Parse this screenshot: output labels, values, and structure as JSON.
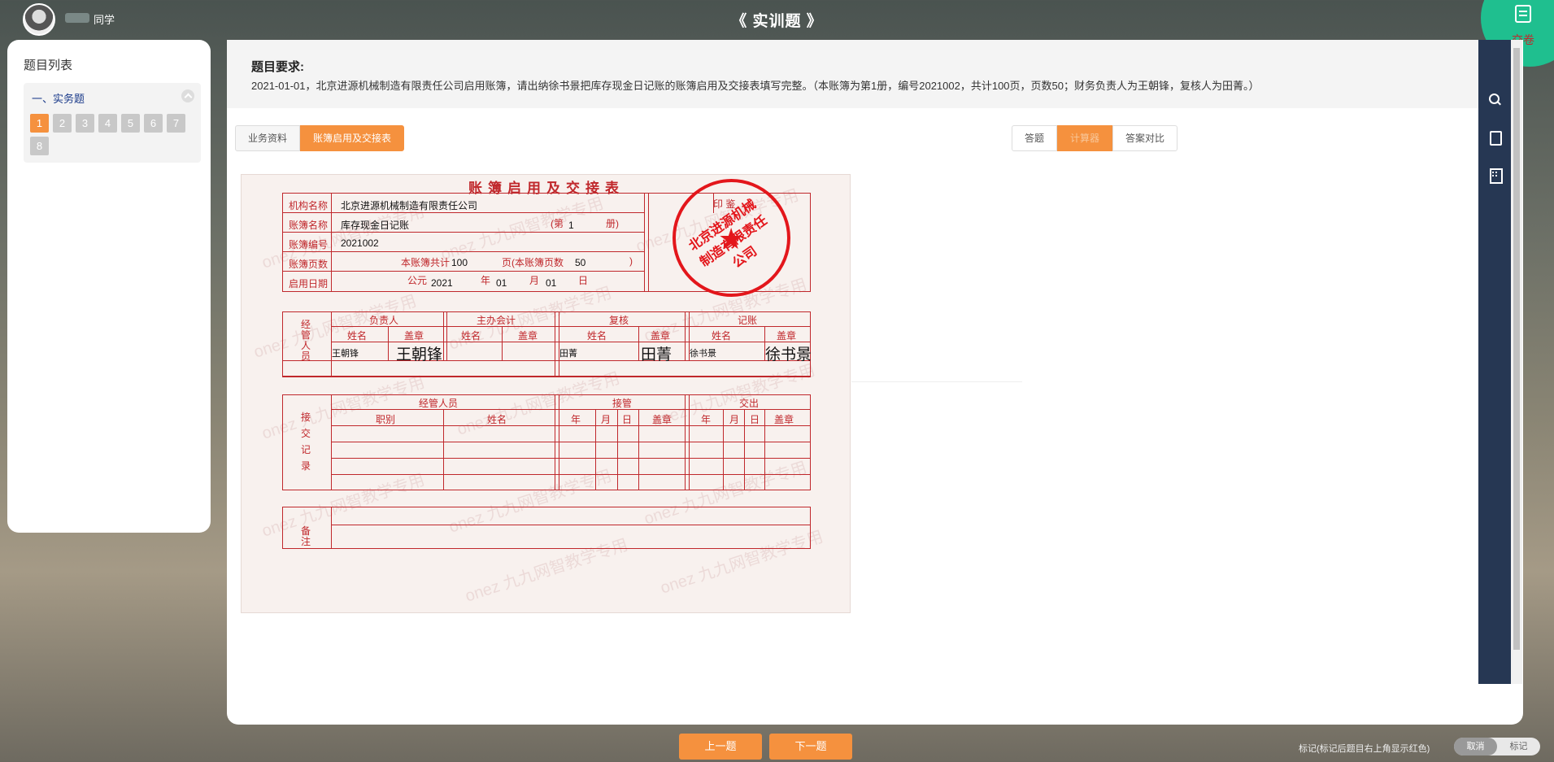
{
  "user": {
    "suffix": "同学"
  },
  "page_title": "《 实训题 》",
  "submit_label": "交卷",
  "left_panel": {
    "title": "题目列表",
    "section_title": "一、实务题",
    "questions": [
      "1",
      "2",
      "3",
      "4",
      "5",
      "6",
      "7",
      "8"
    ],
    "active_question": "1"
  },
  "requirement": {
    "title": "题目要求:",
    "text": "2021-01-01，北京进源机械制造有限责任公司启用账簿，请出纳徐书景把库存现金日记账的账簿启用及交接表填写完整。（本账簿为第1册，编号2021002，共计100页，页数50；财务负责人为王朝锋，复核人为田菁。）"
  },
  "tabs_left": [
    "业务资料",
    "账簿启用及交接表"
  ],
  "tabs_right": [
    "答题",
    "计算器",
    "答案对比"
  ],
  "form": {
    "title": "账簿启用及交接表",
    "rows": {
      "org_label": "机构名称",
      "org_value": "北京进源机械制造有限责任公司",
      "book_label": "账簿名称",
      "book_value": "库存现金日记账",
      "vol_prefix": "(第",
      "vol_value": "1",
      "vol_suffix": "册)",
      "no_label": "账簿编号",
      "no_value": "2021002",
      "pages_label": "账簿页数",
      "pages_total_prefix": "本账簿共计",
      "pages_total": "100",
      "pages_mid": "页(本账簿页数",
      "pages_count": "50",
      "pages_end": ")",
      "date_label": "启用日期",
      "date_prefix": "公元",
      "year": "2021",
      "year_label": "年",
      "month": "01",
      "month_label": "月",
      "day": "01",
      "day_label": "日",
      "seal_label": "印 鉴"
    },
    "managers": {
      "side_label": "经管人员",
      "head": "负责人",
      "acct": "主办会计",
      "review": "复核",
      "keep": "记账",
      "name": "姓名",
      "stamp": "盖章",
      "head_name": "王朝锋",
      "head_sig": "王朝锋",
      "review_name": "田菁",
      "review_sig": "田菁",
      "keep_name": "徐书景",
      "keep_sig": "徐书景"
    },
    "handover": {
      "side_label": "接交记录",
      "staff": "经管人员",
      "take": "接管",
      "give": "交出",
      "post": "职别",
      "name": "姓名",
      "y": "年",
      "m": "月",
      "d": "日",
      "stamp": "盖章"
    },
    "remark_label": "备注",
    "seal_text": "北京进源机械制造有限责任公司",
    "watermark": "onez 九九网智教学专用"
  },
  "bottom": {
    "prev": "上一题",
    "next": "下一题",
    "mark_hint": "标记(标记后题目右上角显示红色)",
    "mark_cancel": "取消",
    "mark_on": "标记"
  }
}
